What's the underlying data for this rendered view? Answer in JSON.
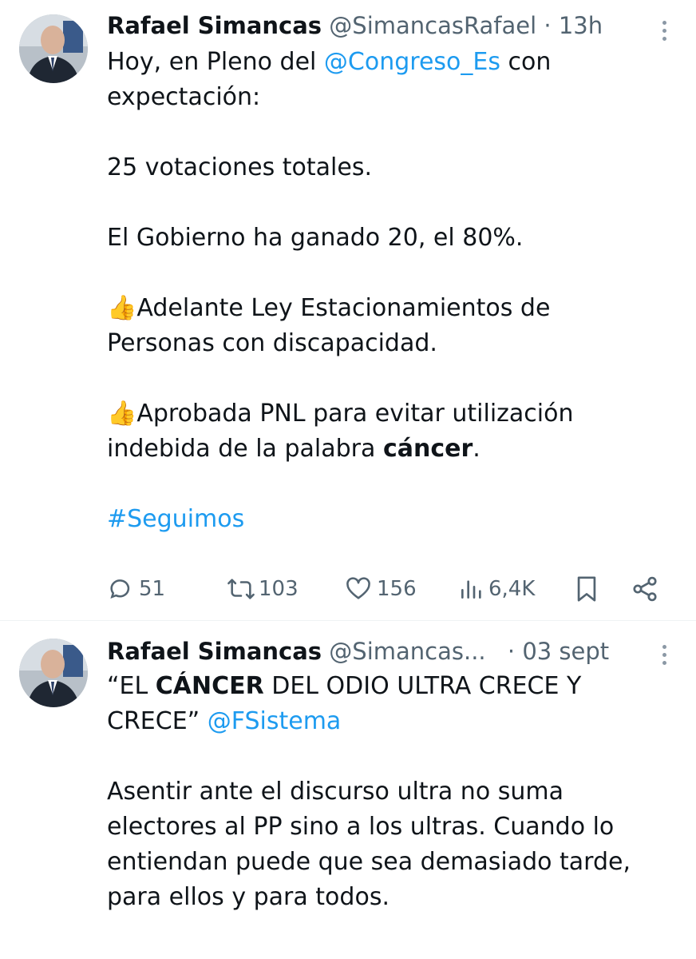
{
  "tweets": [
    {
      "author_name": "Rafael Simancas",
      "handle": "@SimancasRafael",
      "separator": "·",
      "time": "13h",
      "text": {
        "l1_a": "Hoy, en Pleno del ",
        "l1_mention": "@Congreso_Es",
        "l1_b": " con",
        "l2": "expectación:",
        "l3": "25 votaciones totales.",
        "l4": "El Gobierno ha ganado 20, el 80%.",
        "l5_emoji": "👍",
        "l5": "Adelante Ley Estacionamientos de",
        "l6": "Personas con discapacidad.",
        "l7_emoji": "👍",
        "l7": "Aprobada PNL para evitar utilización",
        "l8_a": "indebida de la palabra ",
        "l8_bold": "cáncer",
        "l8_b": ".",
        "hashtag": "#Seguimos"
      },
      "actions": {
        "replies": "51",
        "retweets": "103",
        "likes": "156",
        "views": "6,4K"
      }
    },
    {
      "author_name": "Rafael Simancas",
      "handle": "@Simancas...",
      "separator": "·",
      "time": "03 sept",
      "text": {
        "l1_a": "“EL ",
        "l1_bold": "CÁNCER",
        "l1_b": " DEL ODIO ULTRA CRECE Y",
        "l2_a": "CRECE” ",
        "l2_mention": "@FSistema",
        "l3": "Asentir ante el discurso ultra no suma",
        "l4": "electores al PP sino a los ultras. Cuando lo",
        "l5": "entiendan puede que sea demasiado tarde,",
        "l6": "para ellos y para todos."
      }
    }
  ],
  "colors": {
    "link": "#1d9bf0",
    "text": "#0f1419",
    "muted": "#536471",
    "divider": "#eff3f4"
  },
  "icons": [
    "avatar",
    "more-icon",
    "reply-icon",
    "retweet-icon",
    "like-icon",
    "views-icon",
    "bookmark-icon",
    "share-icon",
    "thumbs-up-emoji"
  ]
}
